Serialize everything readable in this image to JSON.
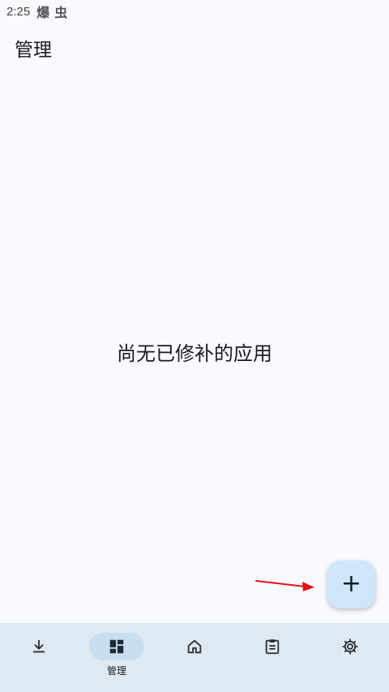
{
  "status_bar": {
    "time": "2:25",
    "icons": [
      "status-glyph-1-icon",
      "status-glyph-2-icon"
    ],
    "glyph_1": "爆",
    "glyph_2": "虫"
  },
  "header": {
    "title": "管理"
  },
  "main": {
    "empty_message": "尚无已修补的应用"
  },
  "fab": {
    "icon": "plus-icon",
    "label": "+"
  },
  "annotation": {
    "color": "#e3121b"
  },
  "bottom_nav": {
    "items": [
      {
        "icon": "download-icon",
        "label": ""
      },
      {
        "icon": "dashboard-icon",
        "label": "管理",
        "active": true
      },
      {
        "icon": "home-icon",
        "label": ""
      },
      {
        "icon": "clipboard-icon",
        "label": ""
      },
      {
        "icon": "gear-icon",
        "label": ""
      }
    ]
  },
  "colors": {
    "background": "#f9fafe",
    "nav_background": "#dfe9f1",
    "nav_active_pill": "#c9dff0",
    "fab_background": "#cfe6fb",
    "text_primary": "#1b1b1f"
  }
}
